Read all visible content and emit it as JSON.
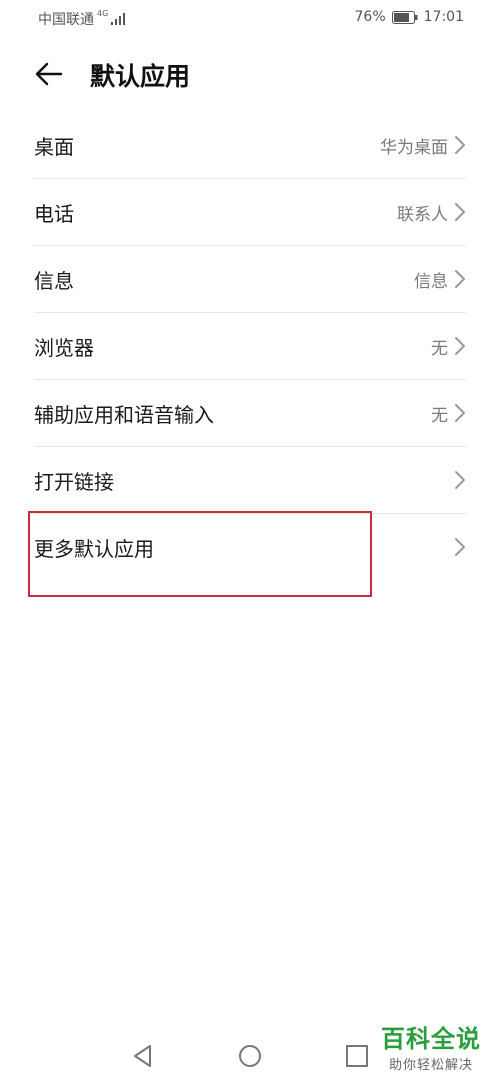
{
  "status_bar": {
    "carrier": "中国联通",
    "network": "4G",
    "battery_percent": "76%",
    "time": "17:01"
  },
  "header": {
    "title": "默认应用"
  },
  "list": {
    "items": [
      {
        "label": "桌面",
        "value": "华为桌面"
      },
      {
        "label": "电话",
        "value": "联系人"
      },
      {
        "label": "信息",
        "value": "信息"
      },
      {
        "label": "浏览器",
        "value": "无"
      },
      {
        "label": "辅助应用和语音输入",
        "value": "无"
      },
      {
        "label": "打开链接",
        "value": ""
      },
      {
        "label": "更多默认应用",
        "value": ""
      }
    ]
  },
  "watermark": {
    "title": "百科全说",
    "subtitle": "助你轻松解决"
  },
  "colors": {
    "highlight": "#cc2b3a",
    "watermark": "#2a9d3c"
  }
}
